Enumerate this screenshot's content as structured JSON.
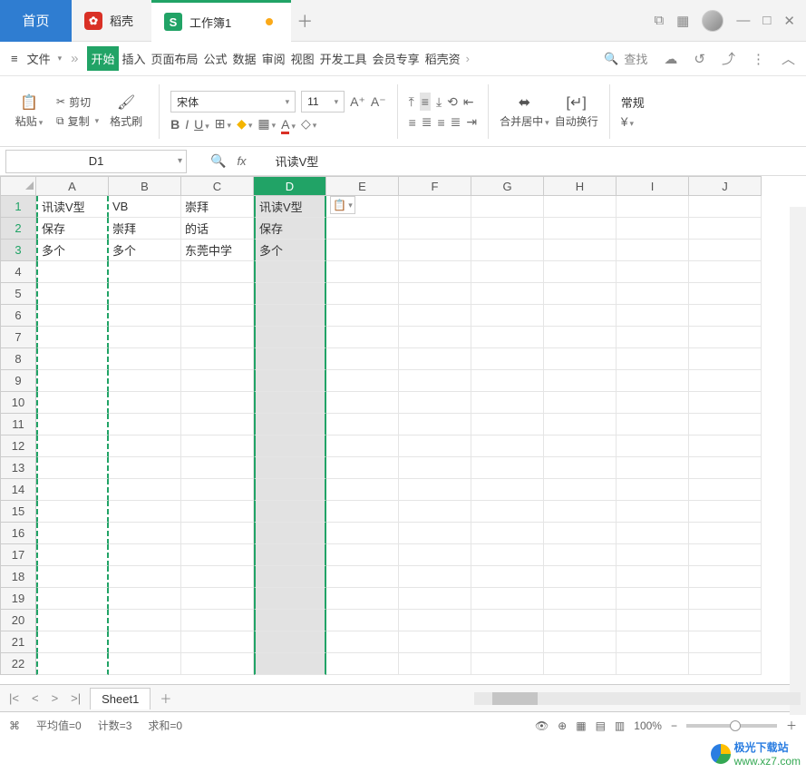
{
  "titlebar": {
    "home": "首页",
    "dk": "稻壳",
    "doc": "工作簿1"
  },
  "menu": {
    "file": "文件",
    "tabs": {
      "start": "开始",
      "insert": "插入",
      "page": "页面布局",
      "formula": "公式",
      "data": "数据",
      "review": "审阅",
      "view": "视图",
      "dev": "开发工具",
      "vip": "会员专享",
      "dk": "稻壳资"
    },
    "search": "查找"
  },
  "ribbon": {
    "paste": "粘贴",
    "cut": "剪切",
    "copy": "复制",
    "format_painter": "格式刷",
    "font_name": "宋体",
    "font_size": "11",
    "merge": "合并居中",
    "wrap": "自动换行",
    "number_format": "常规"
  },
  "fbar": {
    "namebox": "D1",
    "value": "讯读V型"
  },
  "columns": [
    "A",
    "B",
    "C",
    "D",
    "E",
    "F",
    "G",
    "H",
    "I",
    "J"
  ],
  "cells": {
    "A1": "讯读V型",
    "B1": "VB",
    "C1": "崇拜",
    "D1": "讯读V型",
    "A2": "保存",
    "B2": "崇拜",
    "C2": "的话",
    "D2": "保存",
    "A3": "多个",
    "B3": "多个",
    "C3": "东莞中学",
    "D3": "多个"
  },
  "sheet": {
    "name": "Sheet1"
  },
  "status": {
    "avg": "平均值=0",
    "count": "计数=3",
    "sum": "求和=0",
    "zoom": "100%"
  },
  "watermark": {
    "brand": "极光下载站",
    "url": "www.xz7.com"
  }
}
